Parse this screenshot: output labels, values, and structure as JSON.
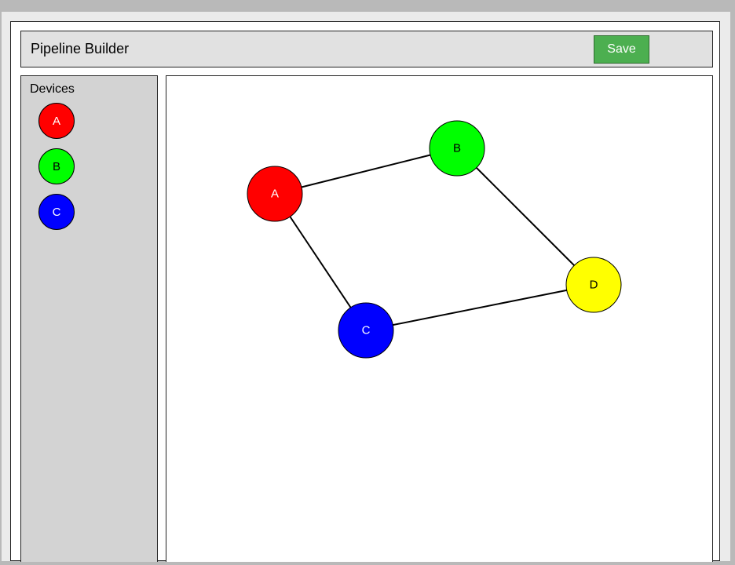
{
  "header": {
    "title": "Pipeline Builder",
    "save_label": "Save"
  },
  "sidebar": {
    "title": "Devices",
    "devices": [
      {
        "label": "A",
        "color": "#ff0000",
        "text_color": "#ffffff"
      },
      {
        "label": "B",
        "color": "#00ff00",
        "text_color": "#000000"
      },
      {
        "label": "C",
        "color": "#0000ff",
        "text_color": "#ffffff"
      }
    ]
  },
  "canvas": {
    "nodes": [
      {
        "id": "A",
        "label": "A",
        "color": "#ff0000",
        "text_color": "#ffffff"
      },
      {
        "id": "B",
        "label": "B",
        "color": "#00ff00",
        "text_color": "#000000"
      },
      {
        "id": "C",
        "label": "C",
        "color": "#0000ff",
        "text_color": "#ffffff"
      },
      {
        "id": "D",
        "label": "D",
        "color": "#ffff00",
        "text_color": "#000000"
      }
    ],
    "edges": [
      {
        "from": "A",
        "to": "B"
      },
      {
        "from": "A",
        "to": "C"
      },
      {
        "from": "B",
        "to": "D"
      },
      {
        "from": "C",
        "to": "D"
      }
    ]
  }
}
